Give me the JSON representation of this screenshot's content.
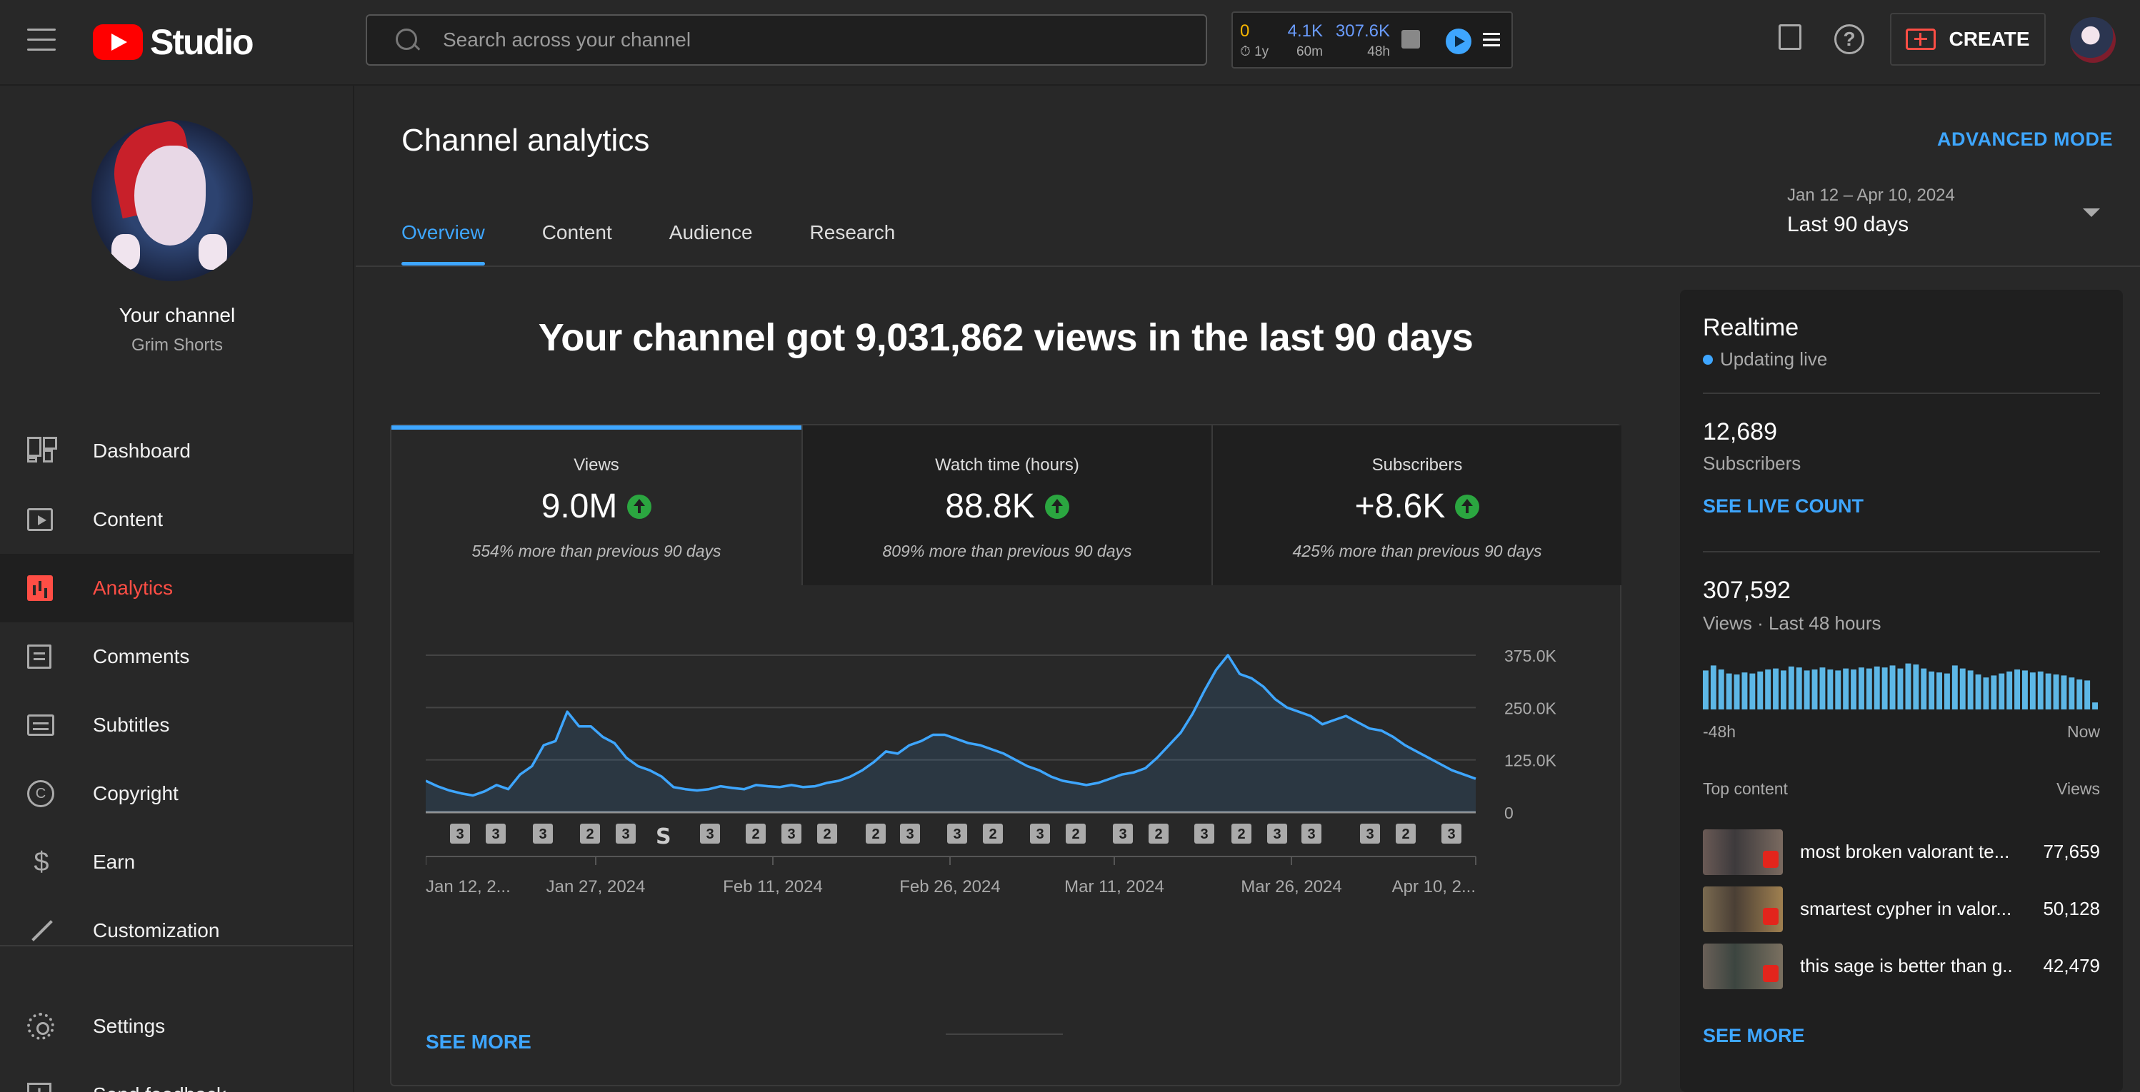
{
  "app": {
    "logo_text": "Studio"
  },
  "topbar": {
    "search_placeholder": "Search across your channel",
    "stats": [
      {
        "value": "0",
        "sub": "⏱ 1y",
        "color": "#f5b400"
      },
      {
        "value": "4.1K",
        "sub": "60m",
        "color": "#6a9cff"
      },
      {
        "value": "307.6K",
        "sub": "48h",
        "color": "#6a9cff"
      }
    ],
    "create_label": "CREATE"
  },
  "sidebar": {
    "channel_name": "Your channel",
    "channel_handle": "Grim Shorts",
    "items": [
      {
        "label": "Dashboard",
        "icon": "dashboard-icon"
      },
      {
        "label": "Content",
        "icon": "content-icon"
      },
      {
        "label": "Analytics",
        "icon": "analytics-icon",
        "active": true
      },
      {
        "label": "Comments",
        "icon": "comments-icon"
      },
      {
        "label": "Subtitles",
        "icon": "subtitles-icon"
      },
      {
        "label": "Copyright",
        "icon": "copyright-icon"
      },
      {
        "label": "Earn",
        "icon": "earn-icon"
      },
      {
        "label": "Customization",
        "icon": "customization-icon"
      }
    ],
    "bottom_items": [
      {
        "label": "Settings",
        "icon": "settings-icon"
      },
      {
        "label": "Send feedback",
        "icon": "feedback-icon"
      }
    ]
  },
  "main": {
    "title": "Channel analytics",
    "advanced_mode": "ADVANCED MODE",
    "tabs": [
      {
        "label": "Overview",
        "active": true
      },
      {
        "label": "Content"
      },
      {
        "label": "Audience"
      },
      {
        "label": "Research"
      }
    ],
    "date_range_sub": "Jan 12 – Apr 10, 2024",
    "date_range_main": "Last 90 days",
    "headline": "Your channel got 9,031,862 views in the last 90 days",
    "metrics": [
      {
        "label": "Views",
        "value": "9.0M",
        "note": "554% more than previous 90 days",
        "active": true
      },
      {
        "label": "Watch time (hours)",
        "value": "88.8K",
        "note": "809% more than previous 90 days"
      },
      {
        "label": "Subscribers",
        "value": "+8.6K",
        "note": "425% more than previous 90 days"
      }
    ],
    "see_more": "SEE MORE"
  },
  "chart_data": {
    "type": "area",
    "series": [
      {
        "values": [
          75,
          62,
          52,
          45,
          40,
          50,
          65,
          55,
          90,
          110,
          160,
          170,
          240,
          205,
          205,
          180,
          165,
          130,
          110,
          100,
          85,
          60,
          55,
          52,
          55,
          62,
          58,
          55,
          65,
          62,
          60,
          65,
          60,
          62,
          70,
          75,
          85,
          100,
          120,
          145,
          140,
          160,
          170,
          185,
          185,
          175,
          165,
          160,
          150,
          140,
          125,
          110,
          100,
          85,
          75,
          70,
          65,
          70,
          80,
          90,
          95,
          105,
          130,
          160,
          190,
          235,
          290,
          340,
          375,
          330,
          320,
          300,
          270,
          250,
          240,
          230,
          210,
          220,
          230,
          215,
          200,
          195,
          180,
          160,
          145,
          130,
          115,
          100,
          90,
          80
        ]
      }
    ],
    "x_tick_labels": [
      "Jan 12, 2...",
      "Jan 27, 2024",
      "Feb 11, 2024",
      "Feb 26, 2024",
      "Mar 11, 2024",
      "Mar 26, 2024",
      "Apr 10, 2..."
    ],
    "y_tick_labels": [
      "375.0K",
      "250.0K",
      "125.0K",
      "0"
    ],
    "ylim": [
      0,
      375000
    ],
    "grid": true,
    "color": "#3ea6ff",
    "upload_markers": [
      "3",
      "3",
      "3",
      "2",
      "3",
      "shorts",
      "3",
      "2",
      "3",
      "2",
      "2",
      "3",
      "3",
      "2",
      "3",
      "2",
      "3",
      "2",
      "3",
      "2",
      "3",
      "3",
      "3",
      "2",
      "3"
    ]
  },
  "realtime": {
    "title": "Realtime",
    "status": "Updating live",
    "subscribers_value": "12,689",
    "subscribers_label": "Subscribers",
    "see_live_count": "SEE LIVE COUNT",
    "views_value": "307,592",
    "views_label": "Views · Last 48 hours",
    "bars": [
      0.78,
      0.88,
      0.8,
      0.72,
      0.7,
      0.74,
      0.72,
      0.76,
      0.8,
      0.82,
      0.78,
      0.86,
      0.84,
      0.78,
      0.8,
      0.84,
      0.8,
      0.78,
      0.82,
      0.8,
      0.84,
      0.82,
      0.86,
      0.84,
      0.88,
      0.82,
      0.92,
      0.9,
      0.82,
      0.76,
      0.74,
      0.72,
      0.88,
      0.82,
      0.78,
      0.7,
      0.64,
      0.68,
      0.72,
      0.76,
      0.8,
      0.78,
      0.74,
      0.76,
      0.72,
      0.7,
      0.68,
      0.64,
      0.6,
      0.58,
      0.14
    ],
    "axis_left": "-48h",
    "axis_right": "Now",
    "top_content_label": "Top content",
    "top_views_label": "Views",
    "top_content": [
      {
        "title": "most broken valorant te...",
        "views": "77,659"
      },
      {
        "title": "smartest cypher in valor...",
        "views": "50,128"
      },
      {
        "title": "this sage is better than g...",
        "views": "42,479"
      }
    ],
    "see_more": "SEE MORE"
  }
}
